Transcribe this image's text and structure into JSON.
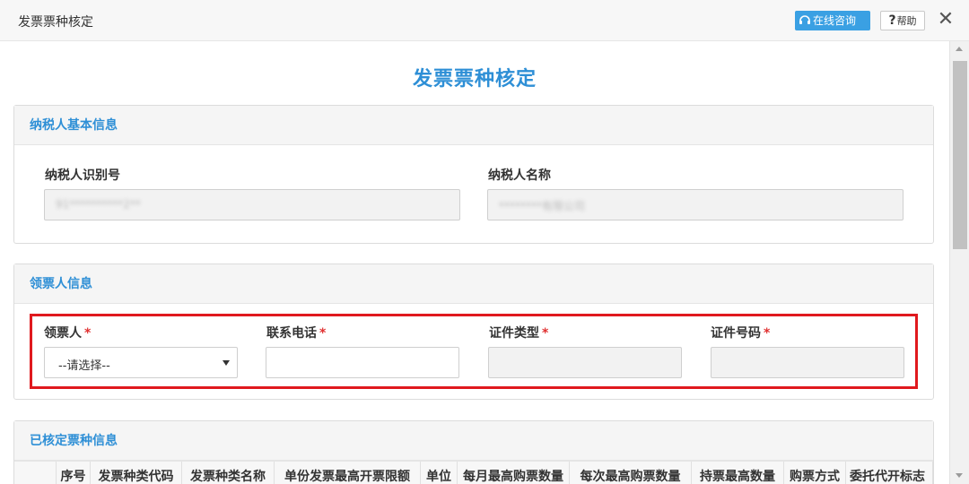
{
  "window": {
    "title": "发票票种核定",
    "consult_label": "在线咨询",
    "help_label": "帮助",
    "close_glyph": "✕"
  },
  "page": {
    "title": "发票票种核定"
  },
  "taxpayer_section": {
    "heading": "纳税人基本信息",
    "id_label": "纳税人识别号",
    "id_value": "91**********2**",
    "name_label": "纳税人名称",
    "name_value": "********有限公司"
  },
  "recipient_section": {
    "heading": "领票人信息",
    "recipient_label": "领票人",
    "recipient_select_value": "--请选择--",
    "phone_label": "联系电话",
    "phone_value": "",
    "id_type_label": "证件类型",
    "id_type_value": "",
    "id_number_label": "证件号码",
    "id_number_value": "",
    "required_mark": "*"
  },
  "approved_section": {
    "heading": "已核定票种信息",
    "columns": [
      "",
      "序号",
      "发票种类代码",
      "发票种类名称",
      "单份发票最高开票限额",
      "单位",
      "每月最高购票数量",
      "每次最高购票数量",
      "持票最高数量",
      "购票方式",
      "委托代开标志"
    ]
  },
  "colors": {
    "accent": "#2e8fd6",
    "consult_button": "#3aa0e3",
    "highlight_border": "#e0191e",
    "required": "#e03030"
  },
  "icons": {
    "consult": "headset-icon",
    "help": "question-icon",
    "close": "close-icon",
    "select_caret": "caret-down-icon"
  }
}
